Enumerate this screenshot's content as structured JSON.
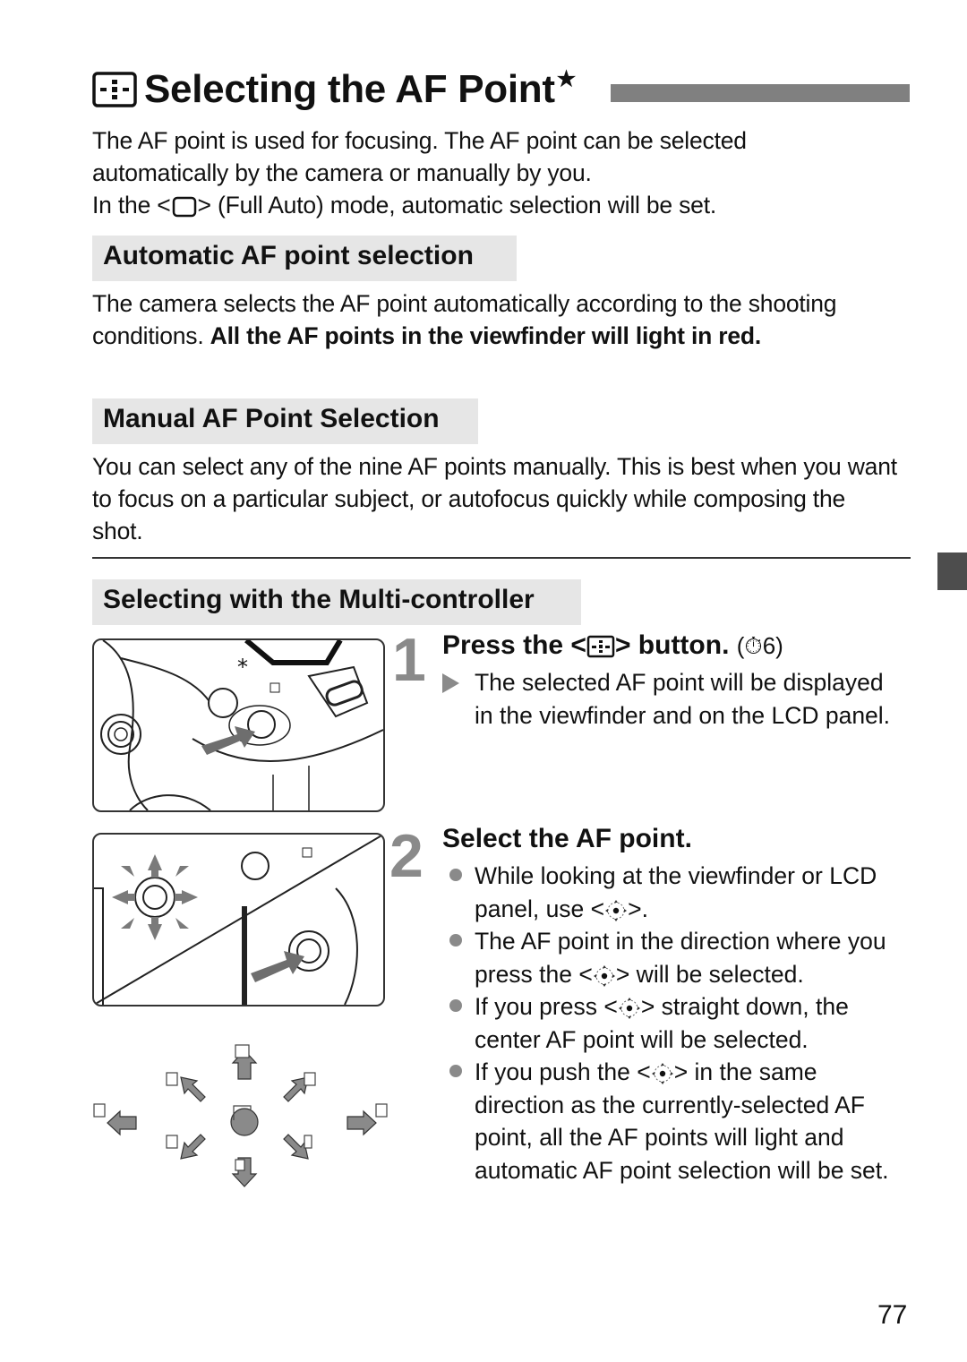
{
  "page": {
    "title": "Selecting the AF Point",
    "title_icon": "af-point-selection-icon",
    "title_marker": "★",
    "intro": {
      "line1": "The AF point is used for focusing. The AF point can be selected",
      "line2": "automatically by the camera or manually by you.",
      "line3_pre": "In the <",
      "line3_icon": "full-auto-mode-icon",
      "line3_post": "> (Full Auto) mode, automatic selection will be set."
    },
    "sections": {
      "automatic": {
        "heading": "Automatic AF point selection",
        "text_plain": "The camera selects the AF point automatically according to the shooting conditions. ",
        "text_bold": "All the AF points in the viewfinder will light in red."
      },
      "manual": {
        "heading": "Manual AF Point Selection",
        "text": "You can select any of the nine AF points manually. This is best when you want to focus on a particular subject, or autofocus quickly while composing the shot."
      },
      "multi_controller": {
        "heading": "Selecting with the Multi-controller"
      }
    },
    "steps": [
      {
        "number": "1",
        "title_pre": "Press the <",
        "title_icon": "af-point-selection-icon",
        "title_post": "> button.",
        "timer_note": "(⏱6)",
        "items": [
          {
            "marker": "triangle",
            "text": "The selected AF point will be displayed in the viewfinder and on the LCD panel."
          }
        ]
      },
      {
        "number": "2",
        "title": "Select the AF point.",
        "items": [
          {
            "marker": "bullet",
            "pre": "While looking at the viewfinder or LCD panel, use <",
            "icon": "multi-controller-icon",
            "post": ">."
          },
          {
            "marker": "bullet",
            "pre": "The AF point in the direction where you press the <",
            "icon": "multi-controller-icon",
            "post": "> will be selected."
          },
          {
            "marker": "bullet",
            "pre": "If you press <",
            "icon": "multi-controller-icon",
            "post": "> straight down, the center AF point will be selected."
          },
          {
            "marker": "bullet",
            "pre": "If you push the <",
            "icon": "multi-controller-icon",
            "post": "> in the same direction as the currently-selected AF point, all the AF points will light and automatic AF point selection will be set."
          }
        ]
      }
    ],
    "illustrations": {
      "camera_button": {
        "label": "camera-af-point-button-illustration",
        "button_marker": "*"
      },
      "multi_controller": {
        "label": "camera-multi-controller-illustration"
      },
      "af_diagram": {
        "label": "af-point-direction-diagram",
        "directions": [
          "up",
          "up-right",
          "right",
          "down-right",
          "down",
          "down-left",
          "left",
          "up-left",
          "center"
        ]
      }
    },
    "page_number": "77"
  },
  "colors": {
    "text": "#111111",
    "heading_bg": "#e6e6e6",
    "title_bar": "#808080",
    "step_number": "#8a8a8a",
    "side_tab": "#4d4d4d",
    "arrow_fill": "#8a8a8a"
  }
}
